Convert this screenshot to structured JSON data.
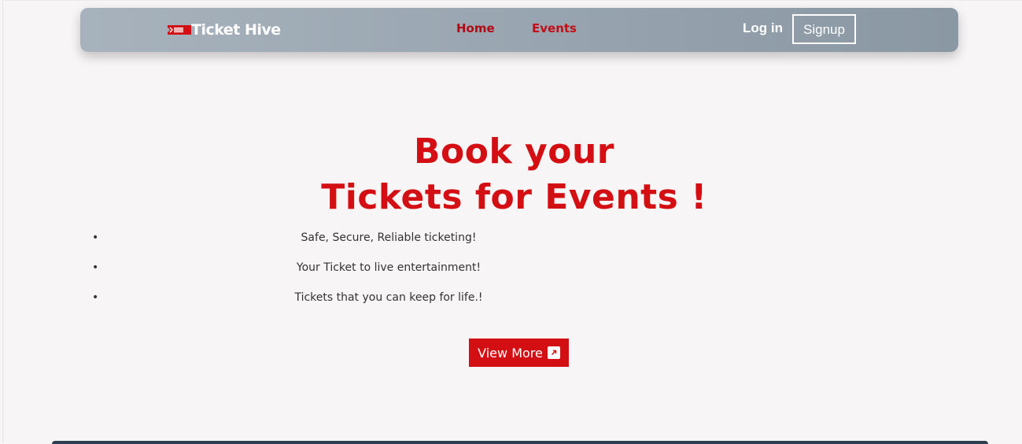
{
  "navbar": {
    "brand": "Ticket Hive",
    "brand_icon": "ticket-icon",
    "links": [
      "Home",
      "Events"
    ],
    "login": "Log in",
    "signup": "Signup"
  },
  "hero": {
    "title_line1": "Book your",
    "title_line2": "Tickets for Events !",
    "features": [
      "Safe, Secure, Reliable ticketing!",
      "Your Ticket to live entertainment!",
      "Tickets that you can keep for life.!"
    ],
    "cta": "View More",
    "cta_icon": "external-link-icon"
  },
  "colors": {
    "accent": "#d40f14",
    "nav_gradient_start": "#a7b2bc",
    "nav_gradient_end": "#8a98a4",
    "background": "#f7f5f6"
  }
}
